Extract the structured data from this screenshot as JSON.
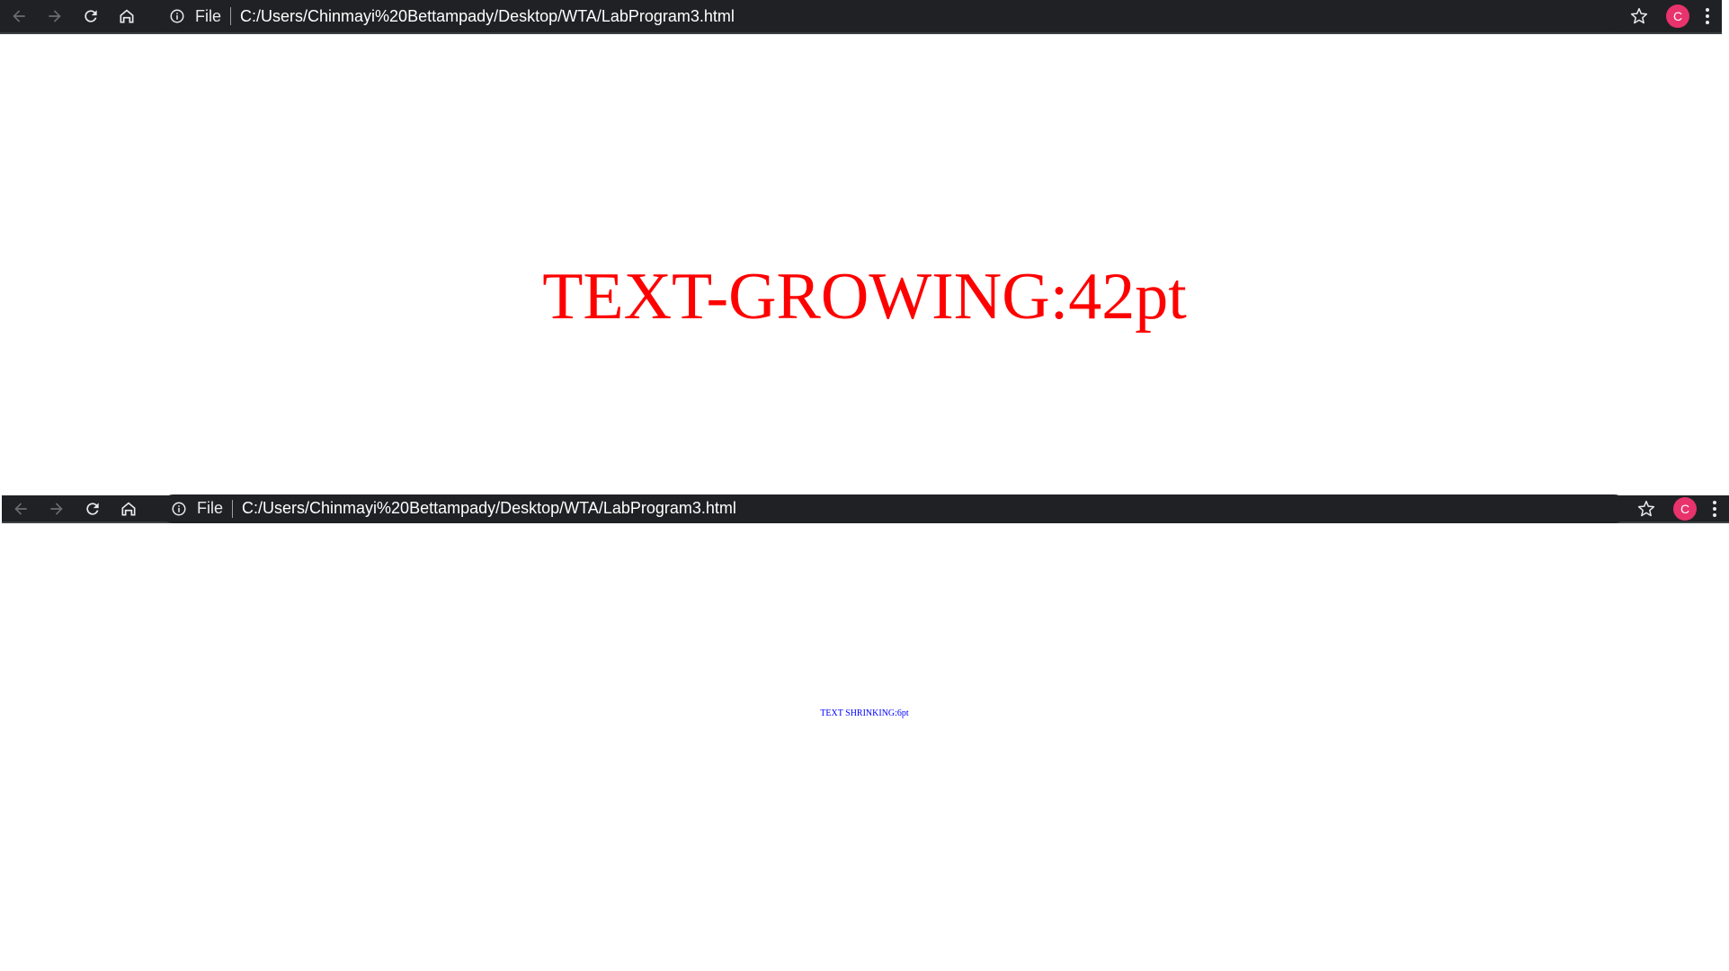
{
  "windows": [
    {
      "toolbar": {
        "scheme_label": "File",
        "url": "C:/Users/Chinmayi%20Bettampady/Desktop/WTA/LabProgram3.html",
        "avatar_letter": "C",
        "icons": [
          "back-arrow-icon",
          "forward-arrow-icon",
          "reload-icon",
          "home-icon",
          "info-icon",
          "star-icon",
          "kebab-menu-icon"
        ]
      },
      "content": {
        "text": "TEXT-GROWING:42pt",
        "color": "#ff0000"
      }
    },
    {
      "toolbar": {
        "scheme_label": "File",
        "url": "C:/Users/Chinmayi%20Bettampady/Desktop/WTA/LabProgram3.html",
        "avatar_letter": "C",
        "icons": [
          "back-arrow-icon",
          "forward-arrow-icon",
          "reload-icon",
          "home-icon",
          "info-icon",
          "star-icon",
          "kebab-menu-icon"
        ]
      },
      "content": {
        "text": "TEXT SHRINKING:6pt",
        "color": "#0000ff"
      }
    }
  ],
  "colors": {
    "toolbar_bg": "#202124",
    "avatar_bg": "#e8336d"
  }
}
